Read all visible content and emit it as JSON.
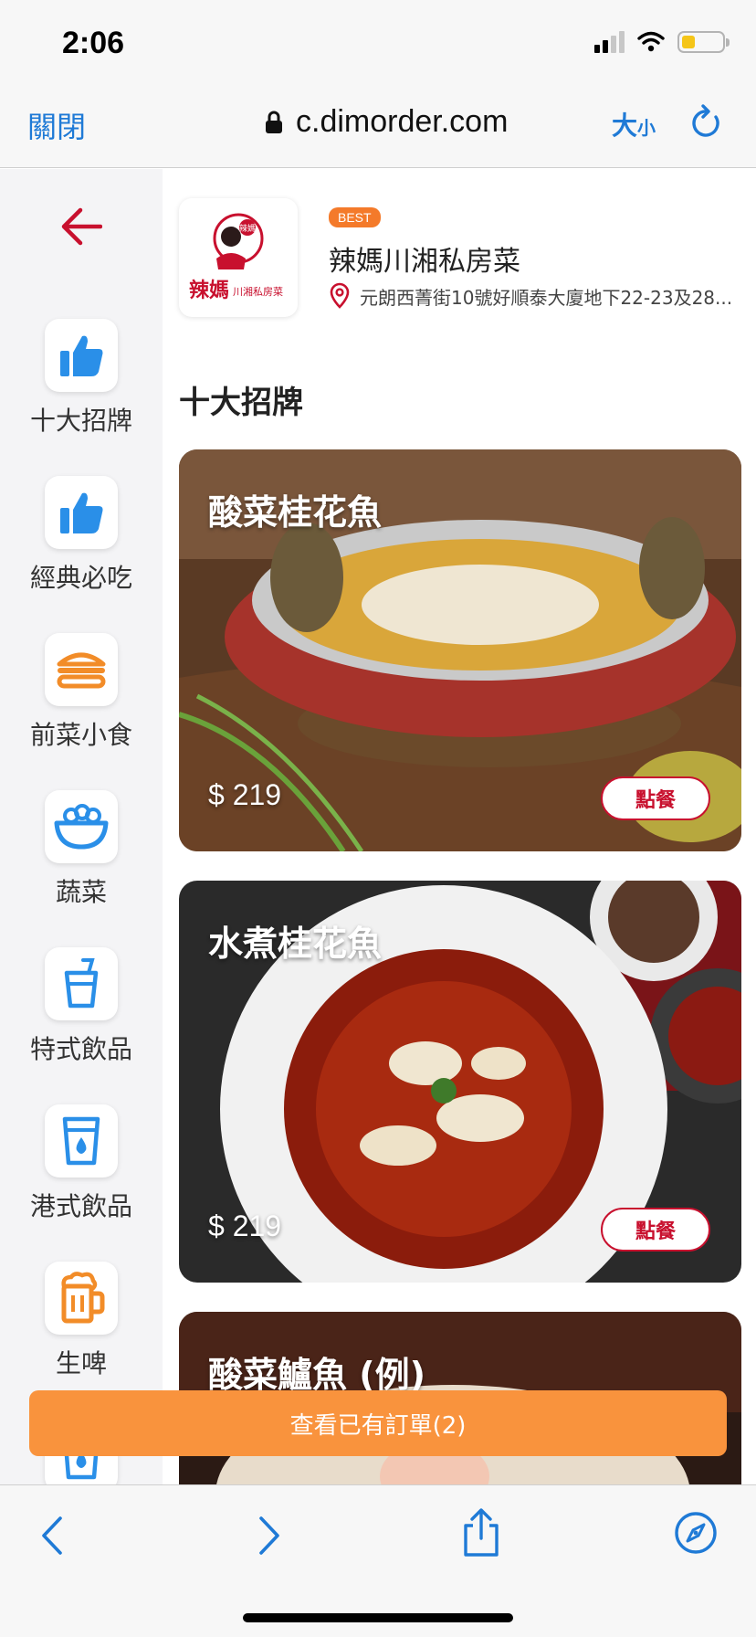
{
  "status": {
    "time": "2:06"
  },
  "browser": {
    "close_label": "關閉",
    "url": "c.dimorder.com",
    "size_label_big": "大",
    "size_label_small": "小"
  },
  "sidebar": {
    "categories": [
      {
        "label": "十大招牌",
        "icon": "thumbs-up-icon"
      },
      {
        "label": "經典必吃",
        "icon": "thumbs-up-icon"
      },
      {
        "label": "前菜小食",
        "icon": "burger-icon"
      },
      {
        "label": "蔬菜",
        "icon": "bowl-icon"
      },
      {
        "label": "特式飲品",
        "icon": "drink-cup-icon"
      },
      {
        "label": "港式飲品",
        "icon": "glass-drop-icon"
      },
      {
        "label": "生啤",
        "icon": "beer-mug-icon"
      }
    ]
  },
  "restaurant": {
    "badge": "BEST",
    "name": "辣媽川湘私房菜",
    "address": "元朗西菁街10號好順泰大廈地下22-23及28...",
    "logo_text_top": "辣媽",
    "logo_text_bottom": "川湘私房菜"
  },
  "section": {
    "title": "十大招牌"
  },
  "dishes": [
    {
      "name": "酸菜桂花魚",
      "price": "$ 219",
      "order_label": "點餐"
    },
    {
      "name": "水煮桂花魚",
      "price": "$ 219",
      "order_label": "點餐"
    },
    {
      "name": "酸菜鱸魚 (例)",
      "price": "",
      "order_label": ""
    }
  ],
  "orders_button": {
    "label": "查看已有訂單(2)"
  },
  "colors": {
    "accent_blue": "#1f7ad6",
    "brand_red": "#c8102e",
    "orange": "#f9933d"
  }
}
